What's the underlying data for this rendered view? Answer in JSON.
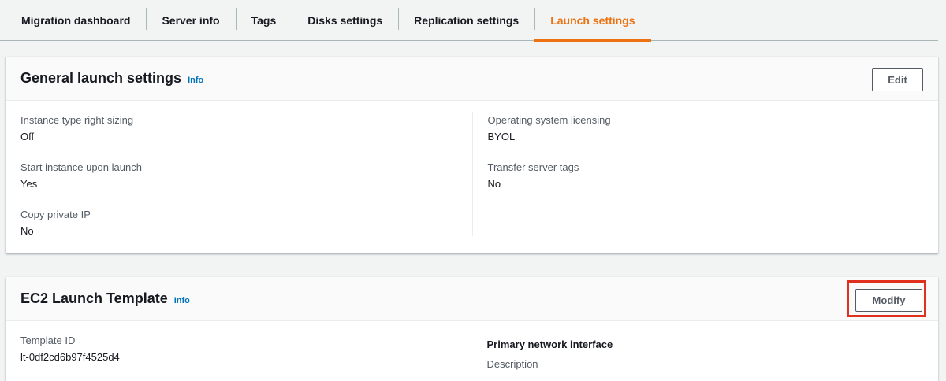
{
  "tabs": [
    {
      "label": "Migration dashboard",
      "active": false
    },
    {
      "label": "Server info",
      "active": false
    },
    {
      "label": "Tags",
      "active": false
    },
    {
      "label": "Disks settings",
      "active": false
    },
    {
      "label": "Replication settings",
      "active": false
    },
    {
      "label": "Launch settings",
      "active": true
    }
  ],
  "general": {
    "title": "General launch settings",
    "info": "Info",
    "edit_label": "Edit",
    "left": [
      {
        "label": "Instance type right sizing",
        "value": "Off"
      },
      {
        "label": "Start instance upon launch",
        "value": "Yes"
      },
      {
        "label": "Copy private IP",
        "value": "No"
      }
    ],
    "right": [
      {
        "label": "Operating system licensing",
        "value": "BYOL"
      },
      {
        "label": "Transfer server tags",
        "value": "No"
      }
    ]
  },
  "ec2": {
    "title": "EC2 Launch Template",
    "info": "Info",
    "modify_label": "Modify",
    "template_id_label": "Template ID",
    "template_id_value": "lt-0df2cd6b97f4525d4",
    "primary_network_interface": "Primary network interface",
    "description_label": "Description"
  },
  "colors": {
    "accent": "#ec7211",
    "link": "#0073bb",
    "highlight": "#e0301e"
  }
}
